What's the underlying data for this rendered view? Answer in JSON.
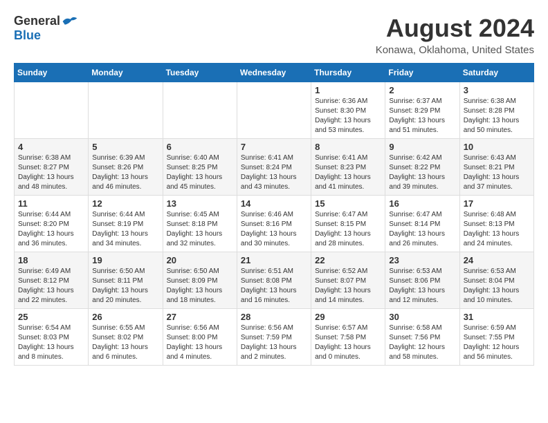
{
  "header": {
    "logo_general": "General",
    "logo_blue": "Blue",
    "month_year": "August 2024",
    "location": "Konawa, Oklahoma, United States"
  },
  "weekdays": [
    "Sunday",
    "Monday",
    "Tuesday",
    "Wednesday",
    "Thursday",
    "Friday",
    "Saturday"
  ],
  "weeks": [
    [
      {
        "day": "",
        "info": ""
      },
      {
        "day": "",
        "info": ""
      },
      {
        "day": "",
        "info": ""
      },
      {
        "day": "",
        "info": ""
      },
      {
        "day": "1",
        "info": "Sunrise: 6:36 AM\nSunset: 8:30 PM\nDaylight: 13 hours\nand 53 minutes."
      },
      {
        "day": "2",
        "info": "Sunrise: 6:37 AM\nSunset: 8:29 PM\nDaylight: 13 hours\nand 51 minutes."
      },
      {
        "day": "3",
        "info": "Sunrise: 6:38 AM\nSunset: 8:28 PM\nDaylight: 13 hours\nand 50 minutes."
      }
    ],
    [
      {
        "day": "4",
        "info": "Sunrise: 6:38 AM\nSunset: 8:27 PM\nDaylight: 13 hours\nand 48 minutes."
      },
      {
        "day": "5",
        "info": "Sunrise: 6:39 AM\nSunset: 8:26 PM\nDaylight: 13 hours\nand 46 minutes."
      },
      {
        "day": "6",
        "info": "Sunrise: 6:40 AM\nSunset: 8:25 PM\nDaylight: 13 hours\nand 45 minutes."
      },
      {
        "day": "7",
        "info": "Sunrise: 6:41 AM\nSunset: 8:24 PM\nDaylight: 13 hours\nand 43 minutes."
      },
      {
        "day": "8",
        "info": "Sunrise: 6:41 AM\nSunset: 8:23 PM\nDaylight: 13 hours\nand 41 minutes."
      },
      {
        "day": "9",
        "info": "Sunrise: 6:42 AM\nSunset: 8:22 PM\nDaylight: 13 hours\nand 39 minutes."
      },
      {
        "day": "10",
        "info": "Sunrise: 6:43 AM\nSunset: 8:21 PM\nDaylight: 13 hours\nand 37 minutes."
      }
    ],
    [
      {
        "day": "11",
        "info": "Sunrise: 6:44 AM\nSunset: 8:20 PM\nDaylight: 13 hours\nand 36 minutes."
      },
      {
        "day": "12",
        "info": "Sunrise: 6:44 AM\nSunset: 8:19 PM\nDaylight: 13 hours\nand 34 minutes."
      },
      {
        "day": "13",
        "info": "Sunrise: 6:45 AM\nSunset: 8:18 PM\nDaylight: 13 hours\nand 32 minutes."
      },
      {
        "day": "14",
        "info": "Sunrise: 6:46 AM\nSunset: 8:16 PM\nDaylight: 13 hours\nand 30 minutes."
      },
      {
        "day": "15",
        "info": "Sunrise: 6:47 AM\nSunset: 8:15 PM\nDaylight: 13 hours\nand 28 minutes."
      },
      {
        "day": "16",
        "info": "Sunrise: 6:47 AM\nSunset: 8:14 PM\nDaylight: 13 hours\nand 26 minutes."
      },
      {
        "day": "17",
        "info": "Sunrise: 6:48 AM\nSunset: 8:13 PM\nDaylight: 13 hours\nand 24 minutes."
      }
    ],
    [
      {
        "day": "18",
        "info": "Sunrise: 6:49 AM\nSunset: 8:12 PM\nDaylight: 13 hours\nand 22 minutes."
      },
      {
        "day": "19",
        "info": "Sunrise: 6:50 AM\nSunset: 8:11 PM\nDaylight: 13 hours\nand 20 minutes."
      },
      {
        "day": "20",
        "info": "Sunrise: 6:50 AM\nSunset: 8:09 PM\nDaylight: 13 hours\nand 18 minutes."
      },
      {
        "day": "21",
        "info": "Sunrise: 6:51 AM\nSunset: 8:08 PM\nDaylight: 13 hours\nand 16 minutes."
      },
      {
        "day": "22",
        "info": "Sunrise: 6:52 AM\nSunset: 8:07 PM\nDaylight: 13 hours\nand 14 minutes."
      },
      {
        "day": "23",
        "info": "Sunrise: 6:53 AM\nSunset: 8:06 PM\nDaylight: 13 hours\nand 12 minutes."
      },
      {
        "day": "24",
        "info": "Sunrise: 6:53 AM\nSunset: 8:04 PM\nDaylight: 13 hours\nand 10 minutes."
      }
    ],
    [
      {
        "day": "25",
        "info": "Sunrise: 6:54 AM\nSunset: 8:03 PM\nDaylight: 13 hours\nand 8 minutes."
      },
      {
        "day": "26",
        "info": "Sunrise: 6:55 AM\nSunset: 8:02 PM\nDaylight: 13 hours\nand 6 minutes."
      },
      {
        "day": "27",
        "info": "Sunrise: 6:56 AM\nSunset: 8:00 PM\nDaylight: 13 hours\nand 4 minutes."
      },
      {
        "day": "28",
        "info": "Sunrise: 6:56 AM\nSunset: 7:59 PM\nDaylight: 13 hours\nand 2 minutes."
      },
      {
        "day": "29",
        "info": "Sunrise: 6:57 AM\nSunset: 7:58 PM\nDaylight: 13 hours\nand 0 minutes."
      },
      {
        "day": "30",
        "info": "Sunrise: 6:58 AM\nSunset: 7:56 PM\nDaylight: 12 hours\nand 58 minutes."
      },
      {
        "day": "31",
        "info": "Sunrise: 6:59 AM\nSunset: 7:55 PM\nDaylight: 12 hours\nand 56 minutes."
      }
    ]
  ]
}
